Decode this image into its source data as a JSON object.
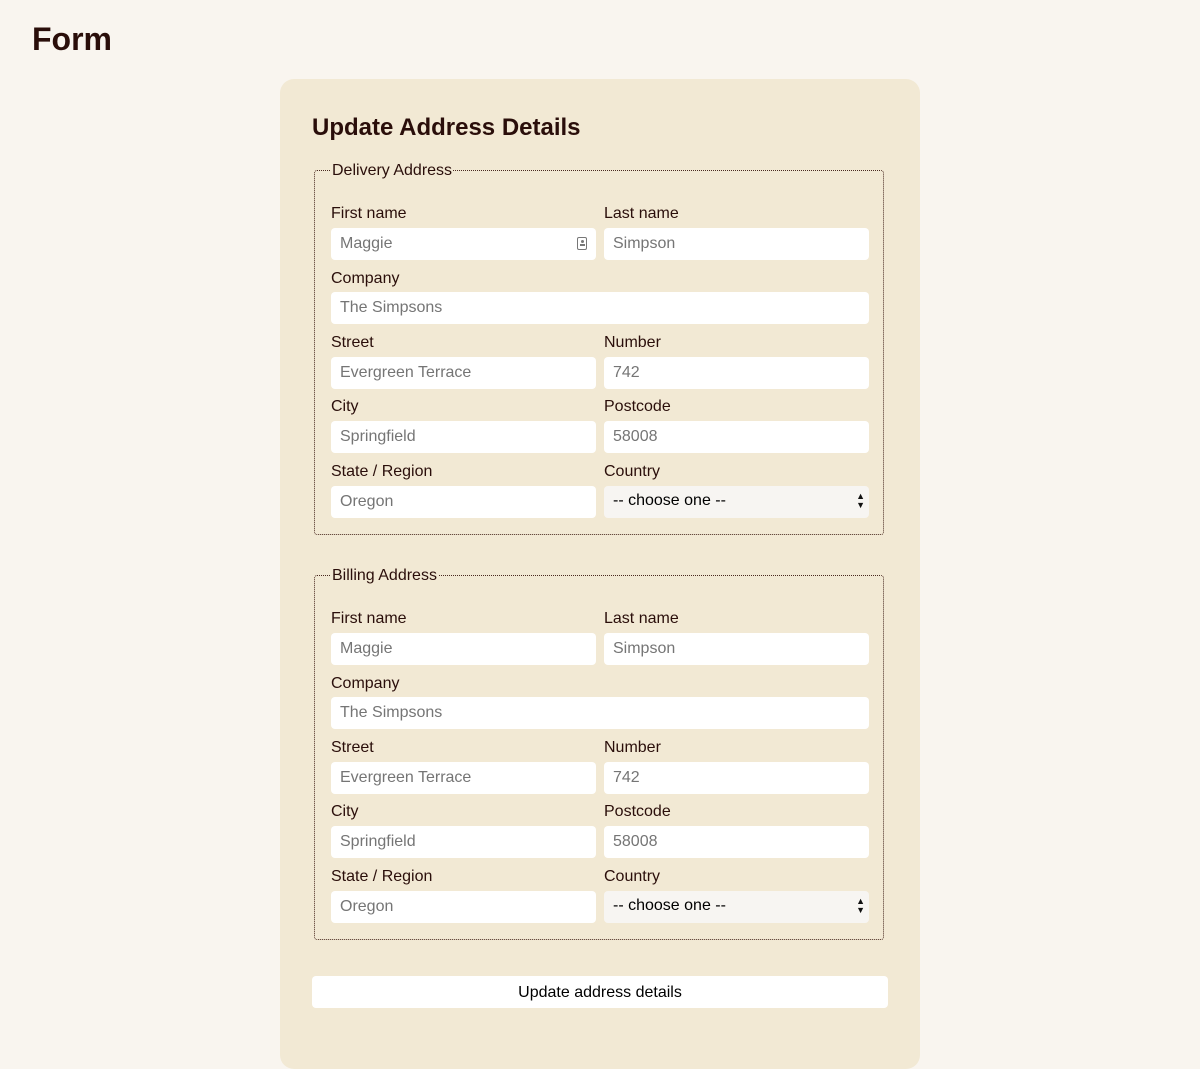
{
  "page": {
    "title": "Form"
  },
  "card": {
    "title": "Update Address Details",
    "submit_label": "Update address details"
  },
  "delivery": {
    "legend": "Delivery Address",
    "first_name": {
      "label": "First name",
      "placeholder": "Maggie"
    },
    "last_name": {
      "label": "Last name",
      "placeholder": "Simpson"
    },
    "company": {
      "label": "Company",
      "placeholder": "The Simpsons"
    },
    "street": {
      "label": "Street",
      "placeholder": "Evergreen Terrace"
    },
    "number": {
      "label": "Number",
      "placeholder": "742"
    },
    "city": {
      "label": "City",
      "placeholder": "Springfield"
    },
    "postcode": {
      "label": "Postcode",
      "placeholder": "58008"
    },
    "state": {
      "label": "State / Region",
      "placeholder": "Oregon"
    },
    "country": {
      "label": "Country",
      "selected": "-- choose one --"
    }
  },
  "billing": {
    "legend": "Billing Address",
    "first_name": {
      "label": "First name",
      "placeholder": "Maggie"
    },
    "last_name": {
      "label": "Last name",
      "placeholder": "Simpson"
    },
    "company": {
      "label": "Company",
      "placeholder": "The Simpsons"
    },
    "street": {
      "label": "Street",
      "placeholder": "Evergreen Terrace"
    },
    "number": {
      "label": "Number",
      "placeholder": "742"
    },
    "city": {
      "label": "City",
      "placeholder": "Springfield"
    },
    "postcode": {
      "label": "Postcode",
      "placeholder": "58008"
    },
    "state": {
      "label": "State / Region",
      "placeholder": "Oregon"
    },
    "country": {
      "label": "Country",
      "selected": "-- choose one --"
    }
  },
  "icons": {
    "autofill": "contact-card-icon",
    "select_arrows": "updown-arrows-icon"
  },
  "colors": {
    "page_bg": "#f9f5ef",
    "card_bg": "#f2e9d4",
    "text": "#2a0e0a"
  }
}
